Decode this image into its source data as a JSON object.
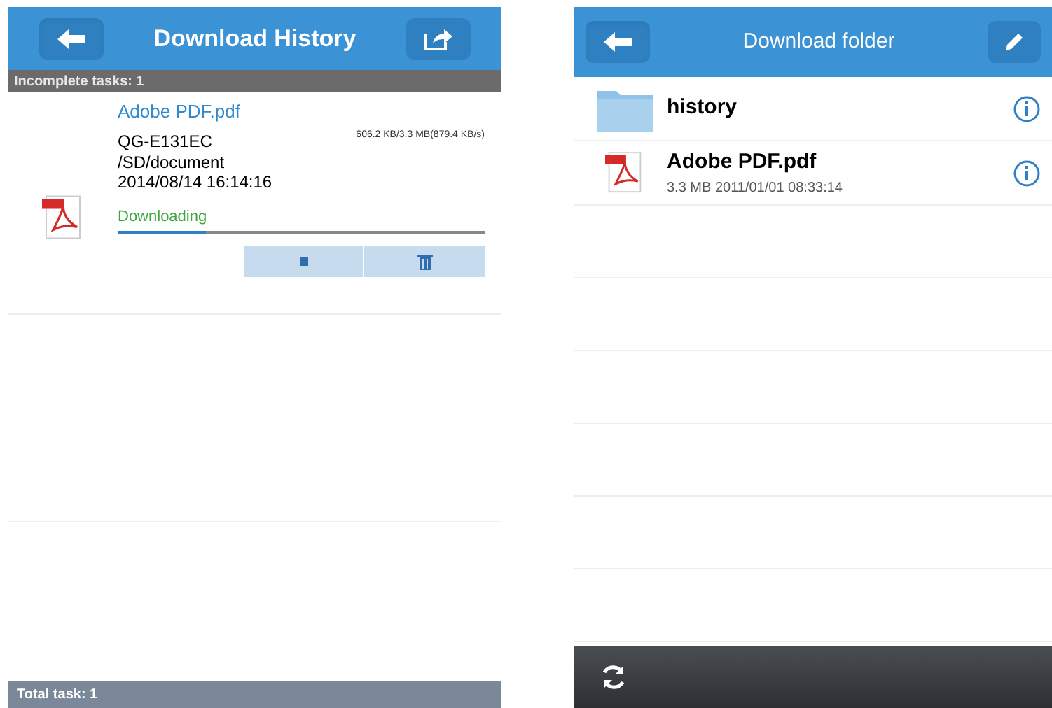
{
  "left": {
    "header": {
      "title": "Download History"
    },
    "incomplete_label": "Incomplete tasks: 1",
    "task": {
      "name": "Adobe PDF.pdf",
      "device": "QG-E131EC",
      "progress_text": "606.2 KB/3.3 MB(879.4 KB/s)",
      "path": "/SD/document",
      "date": "2014/08/14 16:14:16",
      "status": "Downloading",
      "level": 0.24
    },
    "footer": "Total task: 1"
  },
  "right": {
    "header": {
      "title": "Download folder"
    },
    "items": [
      {
        "kind": "folder",
        "name": "history"
      },
      {
        "kind": "pdf",
        "name": "Adobe PDF.pdf",
        "meta": "3.3 MB 2011/01/01 08:33:14"
      }
    ]
  }
}
